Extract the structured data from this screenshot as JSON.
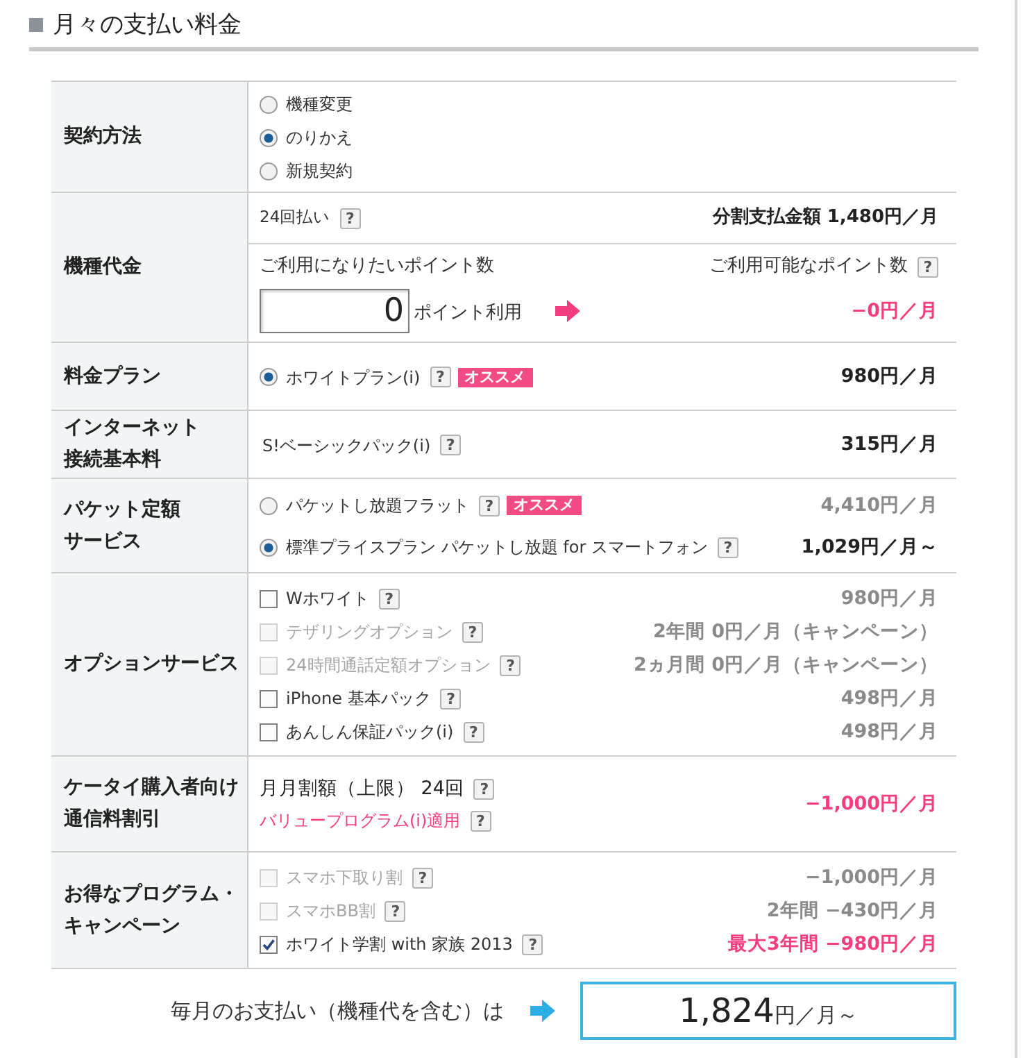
{
  "heading": {
    "title": "月々の支払い料金"
  },
  "rows": [
    {
      "kind": "choices",
      "label_lines": [
        "契約方法"
      ],
      "items": [
        {
          "kind": "radio",
          "label": "機種変更",
          "selected": false
        },
        {
          "kind": "radio",
          "label": "のりかえ",
          "selected": true
        },
        {
          "kind": "radio",
          "label": "新規契約",
          "selected": false
        }
      ]
    },
    {
      "kind": "device",
      "label_lines": [
        "機種代金"
      ],
      "installment": "24回払い",
      "installment_help": "?",
      "installment_total": "分割支払金額 1,480円／月",
      "points_wanted_label": "ご利用になりたいポイント数",
      "points_available_label": "ご利用可能なポイント数",
      "points_available_help": "?",
      "points_value": "0",
      "points_unit": "ポイント利用",
      "points_discount": "−0円／月"
    },
    {
      "kind": "choices",
      "label_lines": [
        "料金プラン"
      ],
      "items": [
        {
          "kind": "radio",
          "label": "ホワイトプラン(i)",
          "help": "?",
          "badge": "オススメ",
          "selected": true,
          "price": "980円／月"
        }
      ]
    },
    {
      "kind": "choices",
      "label_lines": [
        "インターネット",
        "接続基本料"
      ],
      "items": [
        {
          "kind": "text",
          "label": "S!ベーシックパック(i)",
          "help": "?",
          "price": "315円／月"
        }
      ]
    },
    {
      "kind": "choices",
      "label_lines": [
        "パケット定額",
        "サービス"
      ],
      "items": [
        {
          "kind": "radio",
          "label": "パケットし放題フラット",
          "help": "?",
          "badge": "オススメ",
          "selected": false,
          "price": "4,410円／月"
        },
        {
          "kind": "radio",
          "label": "標準プライスプラン パケットし放題 for スマートフォン",
          "help": "?",
          "selected": true,
          "price": "1,029円／月～"
        }
      ]
    },
    {
      "kind": "choices",
      "label_lines": [
        "オプションサービス"
      ],
      "items": [
        {
          "kind": "checkbox",
          "label": "Wホワイト",
          "help": "?",
          "checked": false,
          "disabled": false,
          "price": "980円／月"
        },
        {
          "kind": "checkbox",
          "label": "テザリングオプション",
          "help": "?",
          "checked": false,
          "disabled": true,
          "price": "2年間 0円／月（キャンペーン）"
        },
        {
          "kind": "checkbox",
          "label": "24時間通話定額オプション",
          "help": "?",
          "checked": false,
          "disabled": true,
          "price": "2ヵ月間 0円／月（キャンペーン）"
        },
        {
          "kind": "checkbox",
          "label": "iPhone 基本パック",
          "help": "?",
          "checked": false,
          "disabled": false,
          "price": "498円／月"
        },
        {
          "kind": "checkbox",
          "label": "あんしん保証パック(i)",
          "help": "?",
          "checked": false,
          "disabled": false,
          "price": "498円／月"
        }
      ]
    },
    {
      "kind": "discount",
      "label_lines": [
        "ケータイ購入者向け",
        "通信料割引"
      ],
      "title": "月月割額（上限） 24回",
      "title_help": "?",
      "note": "バリュープログラム(i)適用",
      "note_help": "?",
      "price": "−1,000円／月"
    },
    {
      "kind": "choices",
      "label_lines": [
        "お得なプログラム・",
        "キャンペーン"
      ],
      "items": [
        {
          "kind": "checkbox",
          "label": "スマホ下取り割",
          "help": "?",
          "checked": false,
          "disabled": true,
          "price": "−1,000円／月"
        },
        {
          "kind": "checkbox",
          "label": "スマホBB割",
          "help": "?",
          "checked": false,
          "disabled": true,
          "price": "2年間 −430円／月"
        },
        {
          "kind": "checkbox",
          "label": "ホワイト学割 with 家族 2013",
          "help": "?",
          "checked": true,
          "disabled": false,
          "discount": true,
          "price": "最大3年間 −980円／月"
        }
      ]
    }
  ],
  "total": {
    "label": "毎月のお支払い（機種代を含む）は",
    "amount": "1,824",
    "unit": "円／月～"
  }
}
